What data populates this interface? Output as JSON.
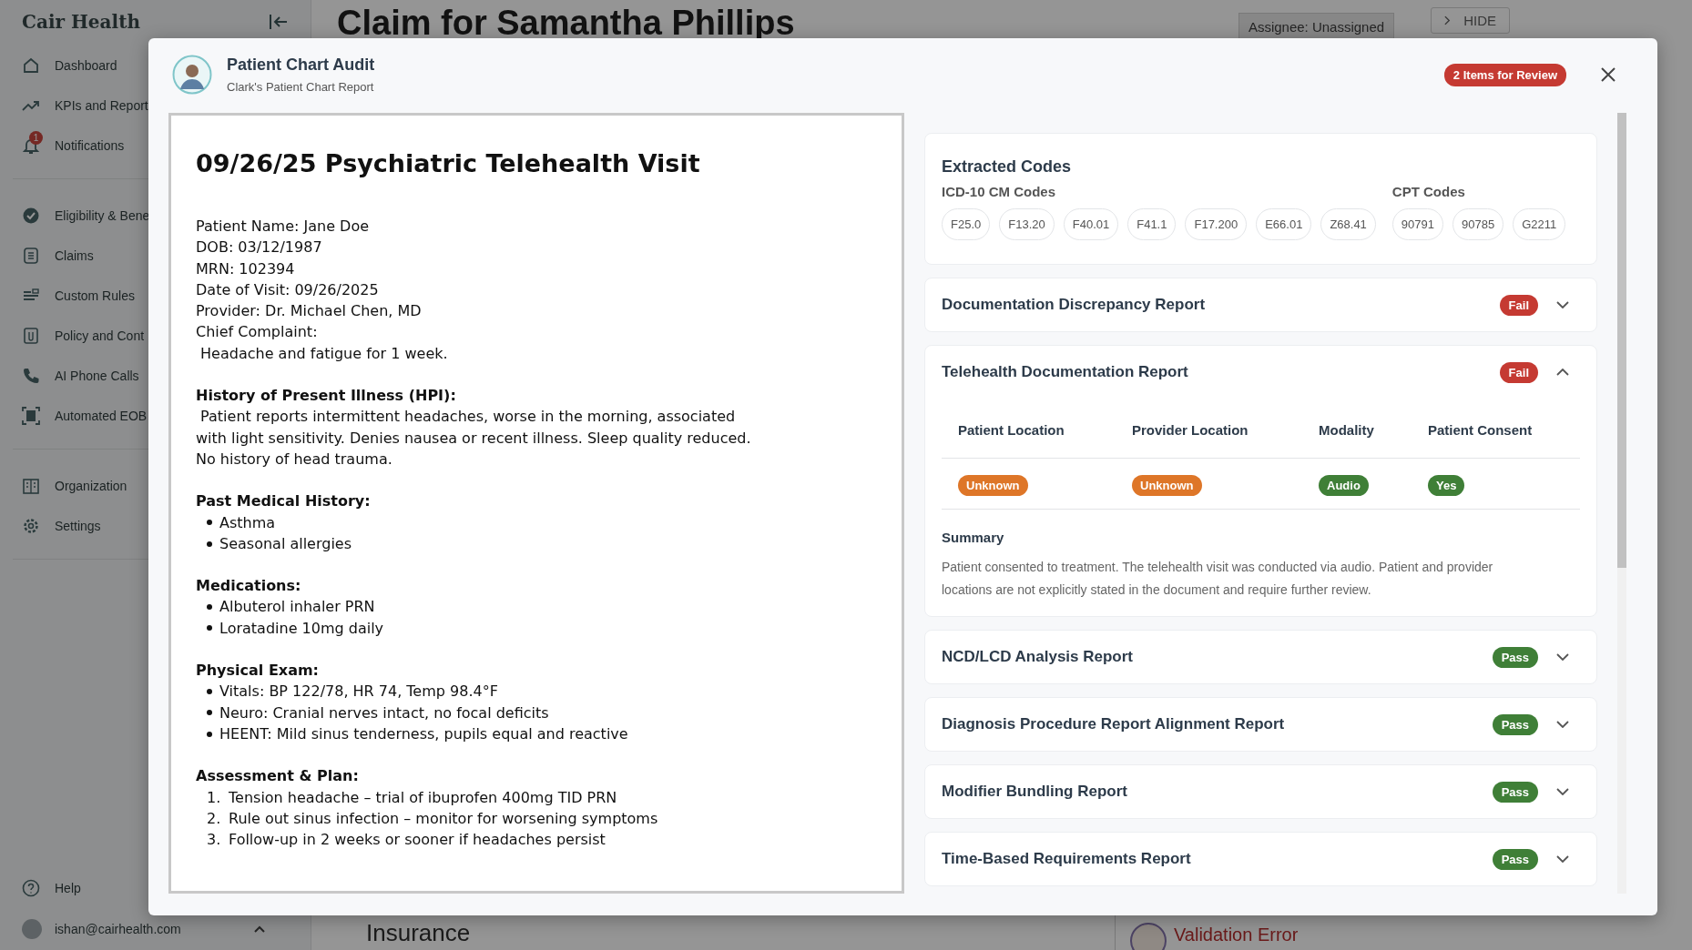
{
  "sidebar": {
    "brand": "Cair Health",
    "groups": [
      [
        {
          "label": "Dashboard"
        },
        {
          "label": "KPIs and Report"
        },
        {
          "label": "Notifications",
          "badge": "1"
        }
      ],
      [
        {
          "label": "Eligibility & Bene"
        },
        {
          "label": "Claims"
        },
        {
          "label": "Custom Rules"
        },
        {
          "label": "Policy and Cont"
        },
        {
          "label": "AI Phone Calls"
        },
        {
          "label": "Automated EOB"
        }
      ],
      [
        {
          "label": "Organization"
        },
        {
          "label": "Settings"
        }
      ]
    ],
    "help": "Help",
    "user": "ishan@cairhealth.com"
  },
  "page": {
    "title": "Claim for Samantha Phillips",
    "assignee": "Assignee: Unassigned",
    "hide": "HIDE",
    "section": "Insurance",
    "error": "Validation Error"
  },
  "modal": {
    "title": "Patient Chart Audit",
    "subtitle": "Clark's Patient Chart Report",
    "review_badge": "2 Items for Review",
    "document": {
      "title": "09/26/25 Psychiatric Telehealth Visit",
      "blocks": [
        {
          "kind": "text",
          "text": "Patient Name: Jane Doe\nDOB: 03/12/1987\nMRN: 102394\nDate of Visit: 09/26/2025\nProvider: Dr. Michael Chen, MD\nChief Complaint:\n Headache and fatigue for 1 week."
        },
        {
          "kind": "text",
          "heading": "History of Present Illness (HPI):",
          "text": " Patient reports intermittent headaches, worse in the morning, associated\nwith light sensitivity. Denies nausea or recent illness. Sleep quality reduced.\nNo history of head trauma."
        },
        {
          "kind": "bullets",
          "heading": "Past Medical History:",
          "items": [
            "Asthma",
            "Seasonal allergies"
          ]
        },
        {
          "kind": "bullets",
          "heading": "Medications:",
          "items": [
            "Albuterol inhaler PRN",
            "Loratadine 10mg daily"
          ]
        },
        {
          "kind": "bullets",
          "heading": "Physical Exam:",
          "items": [
            "Vitals: BP 122/78, HR 74, Temp 98.4°F",
            "Neuro: Cranial nerves intact, no focal deficits",
            "HEENT: Mild sinus tenderness, pupils equal and reactive"
          ]
        },
        {
          "kind": "numbered",
          "heading": "Assessment & Plan:",
          "items": [
            {
              "number": "1.",
              "text": "Tension headache – trial of ibuprofen 400mg TID PRN"
            },
            {
              "number": "2.",
              "text": "Rule out sinus infection – monitor for worsening symptoms"
            },
            {
              "number": "3.",
              "text": "Follow-up in 2 weeks or sooner if headaches persist"
            }
          ]
        }
      ]
    },
    "codes": {
      "title": "Extracted Codes",
      "groups": [
        {
          "label": "ICD-10 CM Codes",
          "codes": [
            "F25.0",
            "F13.20",
            "F40.01",
            "F41.1",
            "F17.200",
            "E66.01",
            "Z68.41"
          ]
        },
        {
          "label": "CPT Codes",
          "codes": [
            "90791",
            "90785",
            "G2211"
          ]
        }
      ]
    },
    "reports": [
      {
        "title": "Documentation Discrepancy Report",
        "kind": "fail",
        "badge": "Fail",
        "expanded": false
      },
      {
        "title": "Telehealth Documentation Report",
        "kind": "fail",
        "badge": "Fail",
        "expanded": true,
        "table": {
          "columns": [
            "Patient Location",
            "Provider Location",
            "Modality",
            "Patient Consent"
          ],
          "values": [
            {
              "text": "Unknown",
              "kind": "warning"
            },
            {
              "text": "Unknown",
              "kind": "warning"
            },
            {
              "text": "Audio",
              "kind": "success"
            },
            {
              "text": "Yes",
              "kind": "success"
            }
          ]
        },
        "summary_label": "Summary",
        "summary": "Patient consented to treatment. The telehealth visit was conducted via audio. Patient and provider locations are not explicitly stated in the document and require further review."
      },
      {
        "title": "NCD/LCD Analysis Report",
        "kind": "pass",
        "badge": "Pass",
        "expanded": false
      },
      {
        "title": "Diagnosis Procedure Report Alignment Report",
        "kind": "pass",
        "badge": "Pass",
        "expanded": false
      },
      {
        "title": "Modifier Bundling Report",
        "kind": "pass",
        "badge": "Pass",
        "expanded": false
      },
      {
        "title": "Time-Based Requirements Report",
        "kind": "pass",
        "badge": "Pass",
        "expanded": false
      }
    ]
  }
}
